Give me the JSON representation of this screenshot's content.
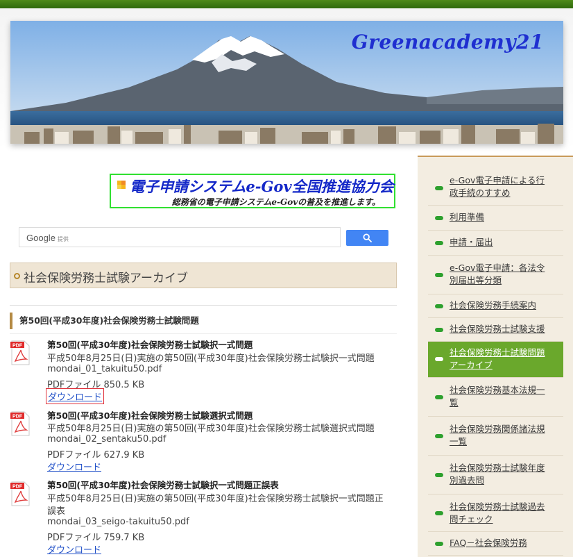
{
  "site": {
    "title": "Greenacademy21"
  },
  "promo": {
    "title": "電子申請システムe-Gov全国推進協力会",
    "subtitle": "総務省の電子申請システムe-Govの普及を推進します。"
  },
  "search": {
    "brand": "Google",
    "brand_suffix": "提供",
    "placeholder": ""
  },
  "archive": {
    "title": "社会保険労務士試験アーカイブ"
  },
  "section": {
    "title": "第50回(平成30年度)社会保険労務士試験問題"
  },
  "items": [
    {
      "title": "第50回(平成30年度)社会保険労務士試験択一式問題",
      "desc": "平成50年8月25日(日)実施の第50回(平成30年度)社会保険労務士試験択一式問題",
      "desc2": "",
      "file": "mondai_01_takuitu50.pdf",
      "size": "PDFファイル 850.5 KB",
      "link": "ダウンロード"
    },
    {
      "title": "第50回(平成30年度)社会保険労務士試験選択式問題",
      "desc": "平成50年8月25日(日)実施の第50回(平成30年度)社会保険労務士試験選択式問題",
      "desc2": "",
      "file": "mondai_02_sentaku50.pdf",
      "size": "PDFファイル 627.9 KB",
      "link": "ダウンロード"
    },
    {
      "title": "第50回(平成30年度)社会保険労務士試験択一式問題正誤表",
      "desc": "平成50年8月25日(日)実施の第50回(平成30年度)社会保険労務士試験択一式問題正",
      "desc2": "誤表",
      "file": "mondai_03_seigo-takuitu50.pdf",
      "size": "PDFファイル 759.7 KB",
      "link": "ダウンロード"
    }
  ],
  "pdf_badge": "PDF",
  "sidebar": {
    "items": [
      {
        "line1": "e-Gov電子申請による行",
        "line2": "政手続のすすめ",
        "active": false
      },
      {
        "line1": "利用準備",
        "line2": "",
        "active": false
      },
      {
        "line1": "申請・届出",
        "line2": "",
        "active": false
      },
      {
        "line1": "e-Gov電子申請：各法令",
        "line2": "別届出等分類",
        "active": false
      },
      {
        "line1": "社会保険労務手続案内",
        "line2": "",
        "active": false
      },
      {
        "line1": "社会保険労務士試験支援",
        "line2": "",
        "active": false
      },
      {
        "line1": "社会保険労務士試験問題",
        "line2": "アーカイブ",
        "active": true
      },
      {
        "line1": "社会保険労務基本法規一",
        "line2": "覧",
        "active": false
      },
      {
        "line1": "社会保険労務関係諸法規",
        "line2": "一覧",
        "active": false
      },
      {
        "line1": "社会保険労務士試験年度",
        "line2": "別過去問",
        "active": false
      },
      {
        "line1": "社会保険労務士試験過去",
        "line2": "問チェック",
        "active": false
      },
      {
        "line1": "FAQ－社会保険労務",
        "line2": "",
        "active": false
      }
    ]
  },
  "colors": {
    "accent": "#6aa82c",
    "link": "#2050c8",
    "promo_border": "#30e030",
    "title_blue": "#1f2fd0"
  },
  "icons": [
    "search-icon",
    "pdf-file-icon",
    "sidebar-bullet-icon",
    "archive-ring-icon"
  ]
}
